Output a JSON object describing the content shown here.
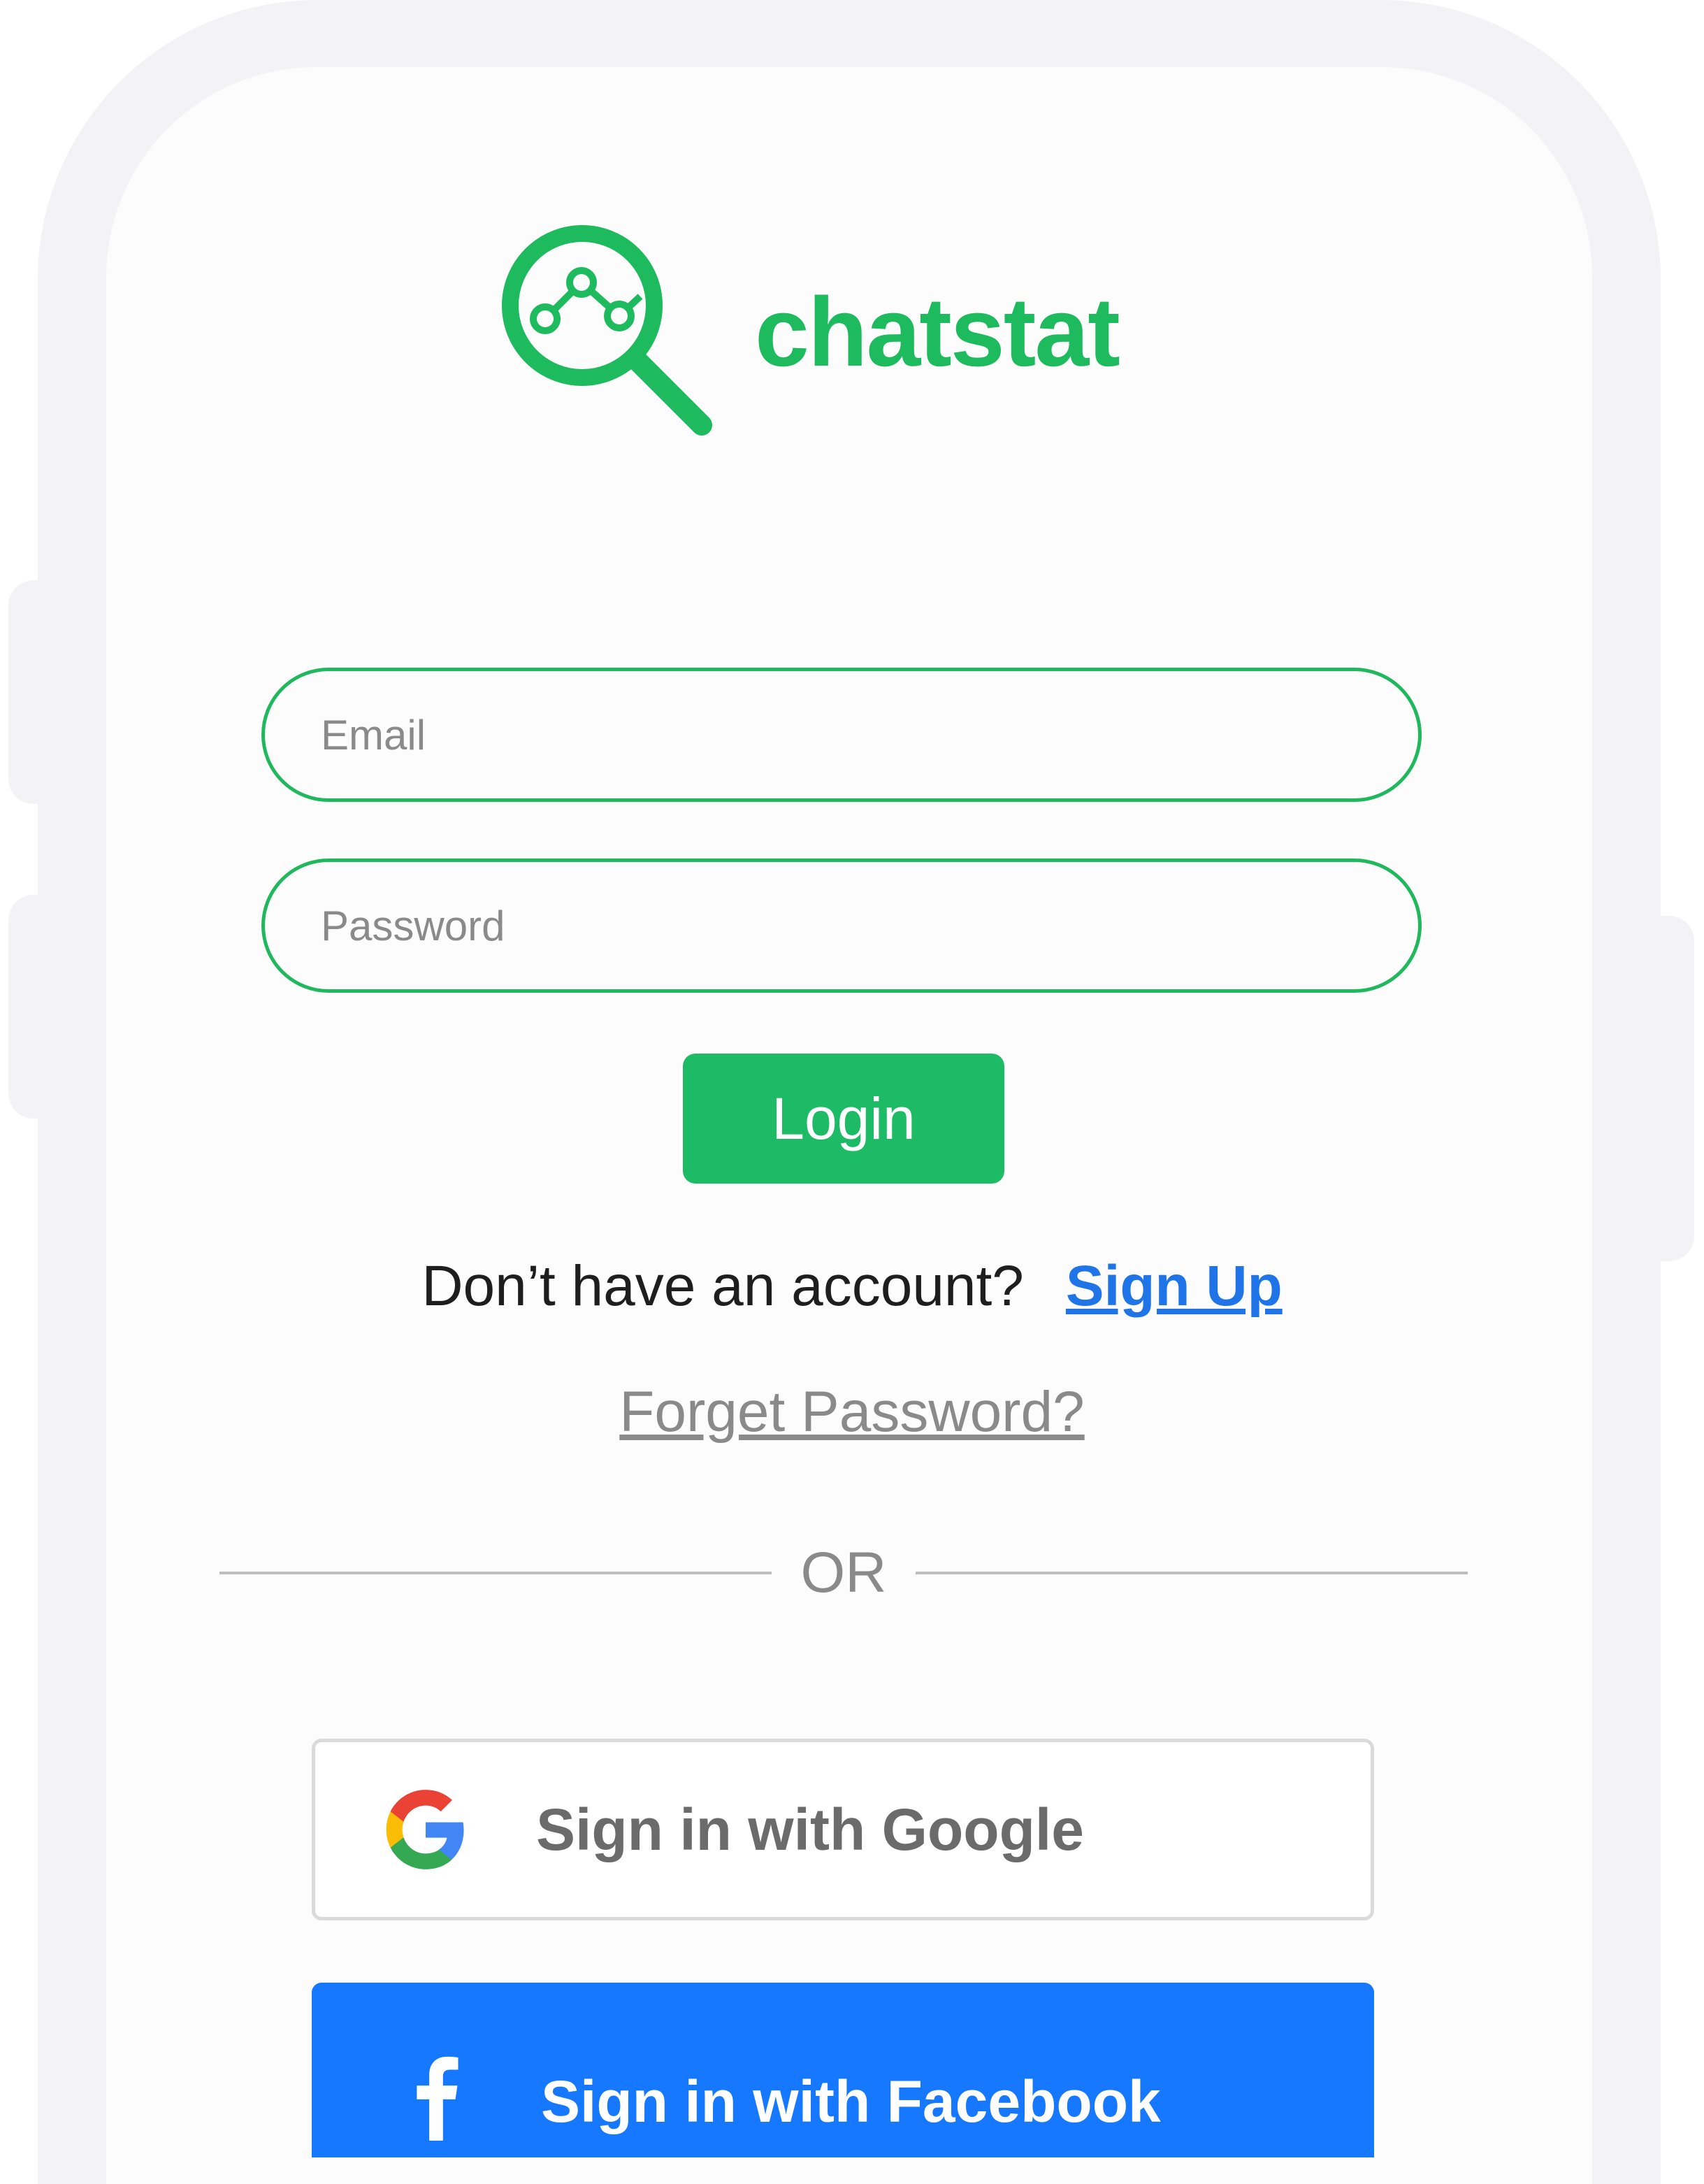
{
  "app": {
    "brand_name": "chatstat",
    "brand_color": "#1dba5e",
    "logo_icon": "magnifier-chart-icon"
  },
  "login_form": {
    "email_placeholder": "Email",
    "password_placeholder": "Password",
    "login_label": "Login",
    "login_color": "#1dbb66"
  },
  "signup_prompt": {
    "text": "Don’t have an account?",
    "link_label": "Sign Up",
    "link_color": "#1f74e8"
  },
  "forgot_password_label": "Forget Password?",
  "divider_label": "OR",
  "social": {
    "google_label": "Sign in with Google",
    "google_icon": "google-g-icon",
    "facebook_label": "Sign in with Facebook",
    "facebook_icon": "facebook-f-icon",
    "facebook_color": "#1677ff"
  }
}
